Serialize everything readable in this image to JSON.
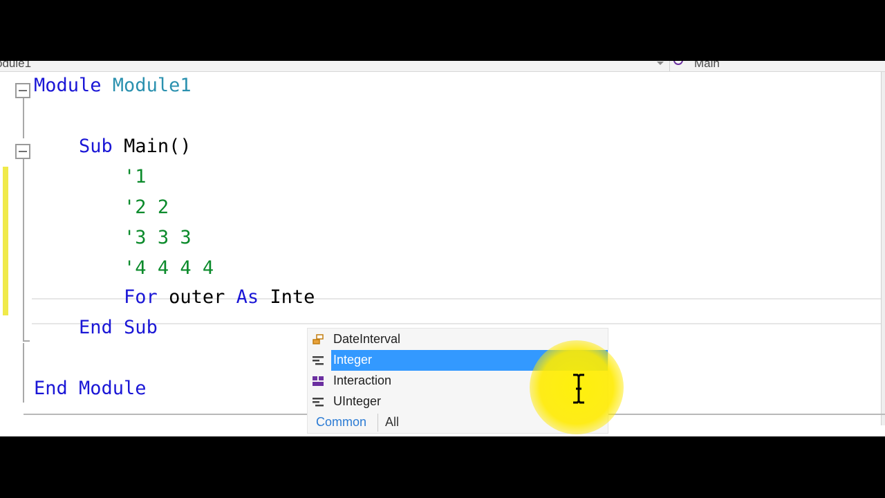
{
  "nav": {
    "left_dropdown": "odule1",
    "right_dropdown": "Main"
  },
  "code_lines": [
    {
      "tokens": [
        {
          "t": "kw",
          "v": "Module "
        },
        {
          "t": "ty",
          "v": "Module1"
        }
      ]
    },
    {
      "tokens": []
    },
    {
      "tokens": [
        {
          "t": "pl",
          "v": "    "
        },
        {
          "t": "kw",
          "v": "Sub "
        },
        {
          "t": "pl",
          "v": "Main()"
        }
      ]
    },
    {
      "tokens": [
        {
          "t": "pl",
          "v": "        "
        },
        {
          "t": "cm",
          "v": "'1"
        }
      ]
    },
    {
      "tokens": [
        {
          "t": "pl",
          "v": "        "
        },
        {
          "t": "cm",
          "v": "'2 2"
        }
      ]
    },
    {
      "tokens": [
        {
          "t": "pl",
          "v": "        "
        },
        {
          "t": "cm",
          "v": "'3 3 3"
        }
      ]
    },
    {
      "tokens": [
        {
          "t": "pl",
          "v": "        "
        },
        {
          "t": "cm",
          "v": "'4 4 4 4"
        }
      ]
    },
    {
      "tokens": [
        {
          "t": "pl",
          "v": "        "
        },
        {
          "t": "kw",
          "v": "For "
        },
        {
          "t": "pl",
          "v": "outer "
        },
        {
          "t": "kw",
          "v": "As "
        },
        {
          "t": "pl",
          "v": "Inte"
        }
      ]
    },
    {
      "tokens": [
        {
          "t": "pl",
          "v": "    "
        },
        {
          "t": "kw",
          "v": "End Sub"
        }
      ]
    },
    {
      "tokens": []
    },
    {
      "tokens": [
        {
          "t": "kw",
          "v": "End Module"
        }
      ]
    }
  ],
  "completion": {
    "items": [
      {
        "label": "DateInterval",
        "icon": "enum-icon",
        "selected": false
      },
      {
        "label": "Integer",
        "icon": "structure-icon",
        "selected": true
      },
      {
        "label": "Interaction",
        "icon": "module-icon",
        "selected": false
      },
      {
        "label": "UInteger",
        "icon": "structure-icon",
        "selected": false
      }
    ],
    "tabs": {
      "common": "Common",
      "all": "All"
    }
  },
  "colors": {
    "keyword": "#1a16d6",
    "type": "#2b91af",
    "comment": "#0a8a2a",
    "selection": "#3399ff",
    "change_marker": "#f0ea4a",
    "cursor_highlight": "#fff000"
  }
}
